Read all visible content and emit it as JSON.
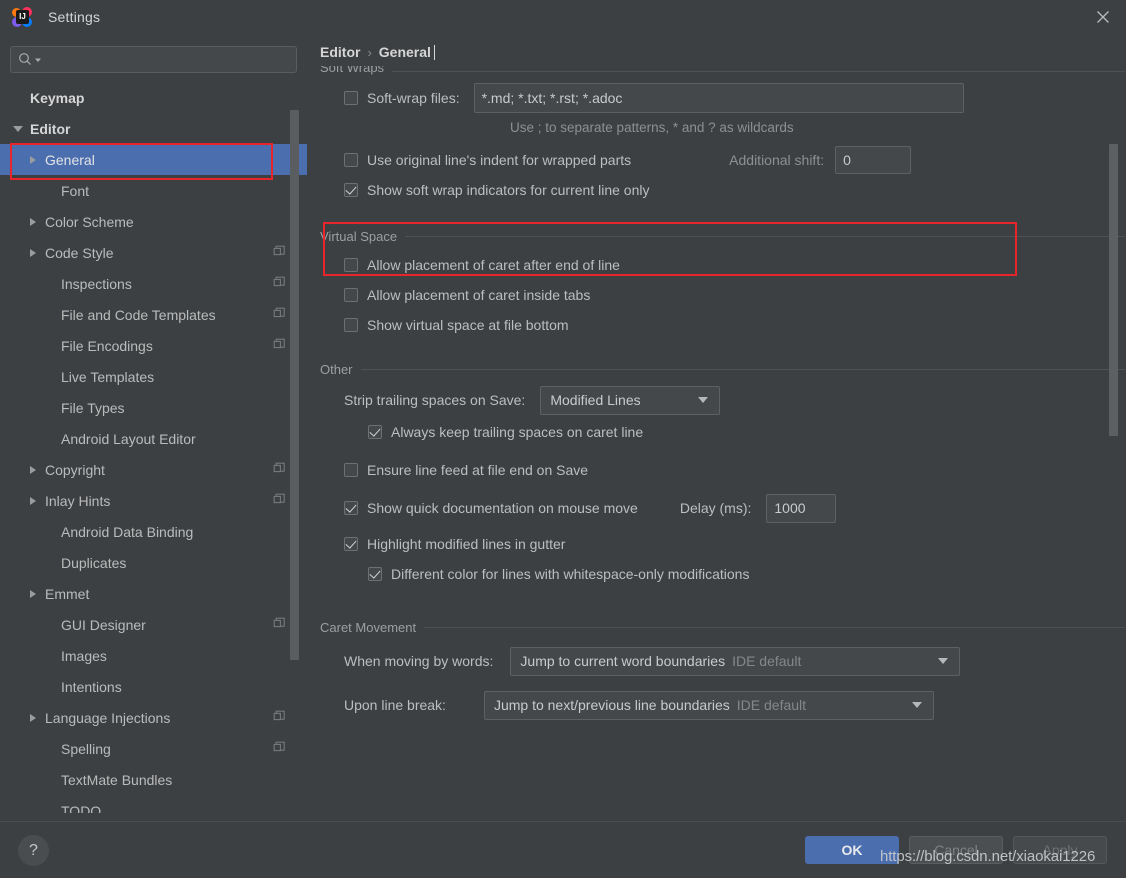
{
  "window": {
    "title": "Settings",
    "app_icon": "intellij-idea-icon",
    "close_icon": "close-icon"
  },
  "sidebar": {
    "search": {
      "placeholder": "",
      "value": "",
      "icon": "search-icon"
    },
    "items": [
      {
        "label": "Keymap",
        "indent": 0,
        "arrow": "none",
        "bold": true,
        "badge": false,
        "selected": false
      },
      {
        "label": "Editor",
        "indent": 0,
        "arrow": "down",
        "bold": true,
        "badge": false,
        "selected": false
      },
      {
        "label": "General",
        "indent": 1,
        "arrow": "right",
        "bold": false,
        "badge": false,
        "selected": true
      },
      {
        "label": "Font",
        "indent": 2,
        "arrow": "none",
        "bold": false,
        "badge": false,
        "selected": false
      },
      {
        "label": "Color Scheme",
        "indent": 1,
        "arrow": "right",
        "bold": false,
        "badge": false,
        "selected": false
      },
      {
        "label": "Code Style",
        "indent": 1,
        "arrow": "right",
        "bold": false,
        "badge": true,
        "selected": false
      },
      {
        "label": "Inspections",
        "indent": 2,
        "arrow": "none",
        "bold": false,
        "badge": true,
        "selected": false
      },
      {
        "label": "File and Code Templates",
        "indent": 2,
        "arrow": "none",
        "bold": false,
        "badge": true,
        "selected": false
      },
      {
        "label": "File Encodings",
        "indent": 2,
        "arrow": "none",
        "bold": false,
        "badge": true,
        "selected": false
      },
      {
        "label": "Live Templates",
        "indent": 2,
        "arrow": "none",
        "bold": false,
        "badge": false,
        "selected": false
      },
      {
        "label": "File Types",
        "indent": 2,
        "arrow": "none",
        "bold": false,
        "badge": false,
        "selected": false
      },
      {
        "label": "Android Layout Editor",
        "indent": 2,
        "arrow": "none",
        "bold": false,
        "badge": false,
        "selected": false
      },
      {
        "label": "Copyright",
        "indent": 1,
        "arrow": "right",
        "bold": false,
        "badge": true,
        "selected": false
      },
      {
        "label": "Inlay Hints",
        "indent": 1,
        "arrow": "right",
        "bold": false,
        "badge": true,
        "selected": false
      },
      {
        "label": "Android Data Binding",
        "indent": 2,
        "arrow": "none",
        "bold": false,
        "badge": false,
        "selected": false
      },
      {
        "label": "Duplicates",
        "indent": 2,
        "arrow": "none",
        "bold": false,
        "badge": false,
        "selected": false
      },
      {
        "label": "Emmet",
        "indent": 1,
        "arrow": "right",
        "bold": false,
        "badge": false,
        "selected": false
      },
      {
        "label": "GUI Designer",
        "indent": 2,
        "arrow": "none",
        "bold": false,
        "badge": true,
        "selected": false
      },
      {
        "label": "Images",
        "indent": 2,
        "arrow": "none",
        "bold": false,
        "badge": false,
        "selected": false
      },
      {
        "label": "Intentions",
        "indent": 2,
        "arrow": "none",
        "bold": false,
        "badge": false,
        "selected": false
      },
      {
        "label": "Language Injections",
        "indent": 1,
        "arrow": "right",
        "bold": false,
        "badge": true,
        "selected": false
      },
      {
        "label": "Spelling",
        "indent": 2,
        "arrow": "none",
        "bold": false,
        "badge": true,
        "selected": false
      },
      {
        "label": "TextMate Bundles",
        "indent": 2,
        "arrow": "none",
        "bold": false,
        "badge": false,
        "selected": false
      },
      {
        "label": "TODO",
        "indent": 2,
        "arrow": "none",
        "bold": false,
        "badge": false,
        "selected": false
      }
    ]
  },
  "breadcrumb": {
    "root": "Editor",
    "separator": "›",
    "current": "General"
  },
  "sections": {
    "soft_wraps": {
      "title": "Soft Wraps",
      "softwrap_files_label": "Soft-wrap files:",
      "softwrap_files_checked": false,
      "softwrap_files_value": "*.md; *.txt; *.rst; *.adoc",
      "hint": "Use ; to separate patterns, * and ? as wildcards",
      "use_original_indent_label": "Use original line's indent for wrapped parts",
      "use_original_indent_checked": false,
      "additional_shift_label": "Additional shift:",
      "additional_shift_value": "0",
      "show_indicators_label": "Show soft wrap indicators for current line only",
      "show_indicators_checked": true
    },
    "virtual_space": {
      "title": "Virtual Space",
      "items": [
        {
          "label": "Allow placement of caret after end of line",
          "checked": false
        },
        {
          "label": "Allow placement of caret inside tabs",
          "checked": false
        },
        {
          "label": "Show virtual space at file bottom",
          "checked": false
        }
      ]
    },
    "other": {
      "title": "Other",
      "strip_trailing_label": "Strip trailing spaces on Save:",
      "strip_trailing_value": "Modified Lines",
      "always_keep_label": "Always keep trailing spaces on caret line",
      "always_keep_checked": true,
      "ensure_linefeed_label": "Ensure line feed at file end on Save",
      "ensure_linefeed_checked": false,
      "quickdoc_label": "Show quick documentation on mouse move",
      "quickdoc_checked": true,
      "delay_label": "Delay (ms):",
      "delay_value": "1000",
      "highlight_modified_label": "Highlight modified lines in gutter",
      "highlight_modified_checked": true,
      "different_color_label": "Different color for lines with whitespace-only modifications",
      "different_color_checked": true
    },
    "caret_movement": {
      "title": "Caret Movement",
      "when_moving_label": "When moving by words:",
      "when_moving_value": "Jump to current word boundaries",
      "when_moving_suffix": "IDE default",
      "upon_linebreak_label": "Upon line break:",
      "upon_linebreak_value": "Jump to next/previous line boundaries",
      "upon_linebreak_suffix": "IDE default"
    }
  },
  "footer": {
    "help_label": "?",
    "ok_label": "OK",
    "cancel_label": "Cancel",
    "apply_label": "Apply",
    "watermark": "https://blog.csdn.net/xiaokai1226"
  },
  "colors": {
    "accent_blue": "#4b6eaf",
    "annotation_red": "#e8252a",
    "panel_bg": "#3c4043",
    "field_bg": "#45484a"
  }
}
